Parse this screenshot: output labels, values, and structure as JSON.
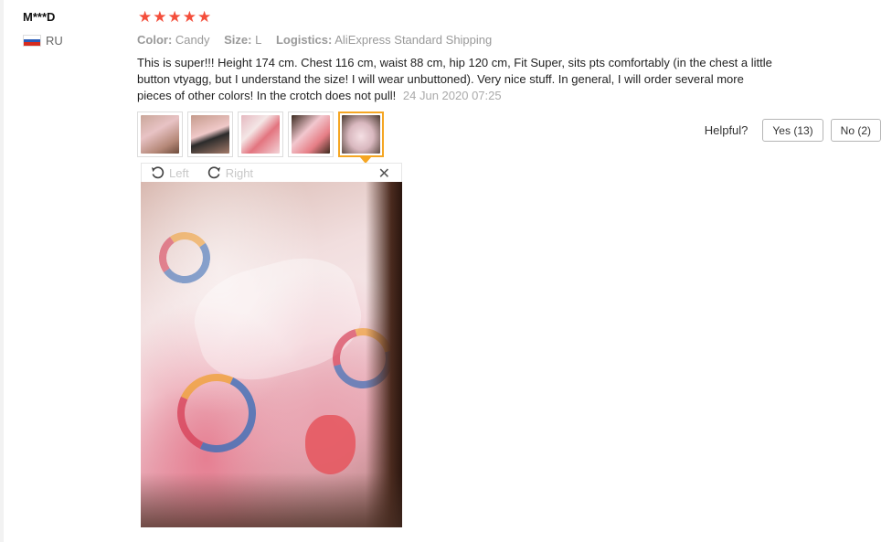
{
  "review": {
    "user_name": "M***D",
    "country_code": "RU",
    "rating": 5,
    "stars": [
      "★",
      "★",
      "★",
      "★",
      "★"
    ],
    "star_color": "#f44e3b",
    "meta": {
      "color_label": "Color:",
      "color_value": "Candy",
      "size_label": "Size:",
      "size_value": "L",
      "logistics_label": "Logistics:",
      "logistics_value": "AliExpress Standard Shipping"
    },
    "text": "This is super!!! Height 174 cm. Chest 116 cm, waist 88 cm, hip 120 cm, Fit Super, sits pts comfortably (in the chest a little button vtyagg, but I understand the size! I will wear unbuttoned). Very nice stuff. In general, I will order several more pieces of other colors! In the crotch does not pull!",
    "date": "24 Jun 2020 07:25",
    "thumbnails": [
      "review-photo-1",
      "review-photo-2",
      "review-photo-3",
      "review-photo-4",
      "review-photo-5"
    ],
    "selected_thumbnail": 5
  },
  "viewer": {
    "rotate_left_label": "Left",
    "rotate_right_label": "Right",
    "close_icon": "close-icon"
  },
  "helpful": {
    "label": "Helpful?",
    "yes_label": "Yes (13)",
    "no_label": "No (2)"
  },
  "colors": {
    "accent": "#f5a623",
    "flag": [
      "#ffffff",
      "#2a5cb8",
      "#d52b1e"
    ]
  }
}
